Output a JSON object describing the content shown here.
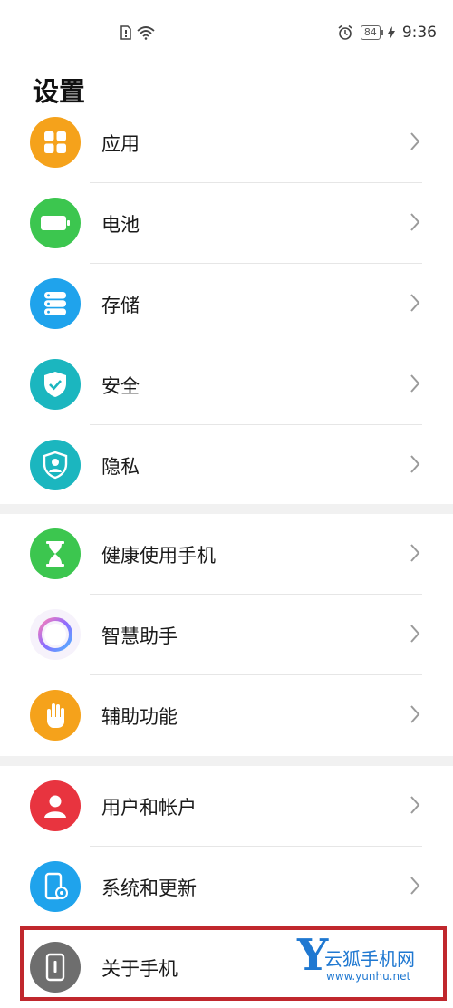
{
  "status_bar": {
    "battery": "84",
    "time": "9:36"
  },
  "page": {
    "title": "设置"
  },
  "groups": [
    {
      "items": [
        {
          "label": "应用",
          "icon": "apps-icon",
          "color": "#f5a21b"
        },
        {
          "label": "电池",
          "icon": "battery-icon",
          "color": "#3cc64f"
        },
        {
          "label": "存储",
          "icon": "storage-icon",
          "color": "#1fa3ec"
        },
        {
          "label": "安全",
          "icon": "shield-icon",
          "color": "#1bb6bf"
        },
        {
          "label": "隐私",
          "icon": "privacy-icon",
          "color": "#1bb6bf"
        }
      ]
    },
    {
      "items": [
        {
          "label": "健康使用手机",
          "icon": "hourglass-icon",
          "color": "#3cc64f"
        },
        {
          "label": "智慧助手",
          "icon": "assistant-icon",
          "color": "#ffffff"
        },
        {
          "label": "辅助功能",
          "icon": "hand-icon",
          "color": "#f5a21b"
        }
      ]
    },
    {
      "items": [
        {
          "label": "用户和帐户",
          "icon": "user-icon",
          "color": "#e8343f"
        },
        {
          "label": "系统和更新",
          "icon": "system-update-icon",
          "color": "#1fa3ec"
        },
        {
          "label": "关于手机",
          "icon": "phone-info-icon",
          "color": "#6e6e6e"
        }
      ]
    }
  ],
  "watermark": {
    "letter": "Y",
    "name": "云狐手机网",
    "url": "www.yunhu.net"
  }
}
